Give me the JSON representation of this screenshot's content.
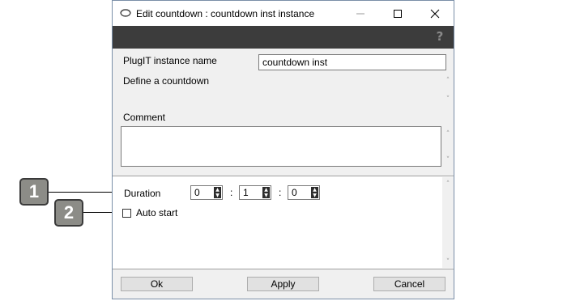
{
  "window": {
    "title": "Edit countdown : countdown inst instance",
    "minimize_icon": "minimize-icon",
    "maximize_icon": "maximize-icon",
    "close_icon": "close-icon"
  },
  "toolbar": {
    "help_icon": "help-icon",
    "help_glyph": "?"
  },
  "form": {
    "instance_name_label": "PlugIT instance name",
    "instance_name_value": "countdown inst",
    "description": "Define a countdown",
    "comment_label": "Comment",
    "comment_value": ""
  },
  "settings": {
    "duration_label": "Duration",
    "duration_hours": "0",
    "duration_minutes": "1",
    "duration_seconds": "0",
    "separator": ":",
    "auto_start_label": "Auto start",
    "auto_start_checked": false
  },
  "buttons": {
    "ok": "Ok",
    "apply": "Apply",
    "cancel": "Cancel"
  },
  "callouts": {
    "one": "1",
    "two": "2"
  },
  "colors": {
    "toolbar_bg": "#3c3c3c",
    "callout_bg": "#8c8c87",
    "spin_buttons": "#2d2d2d"
  }
}
